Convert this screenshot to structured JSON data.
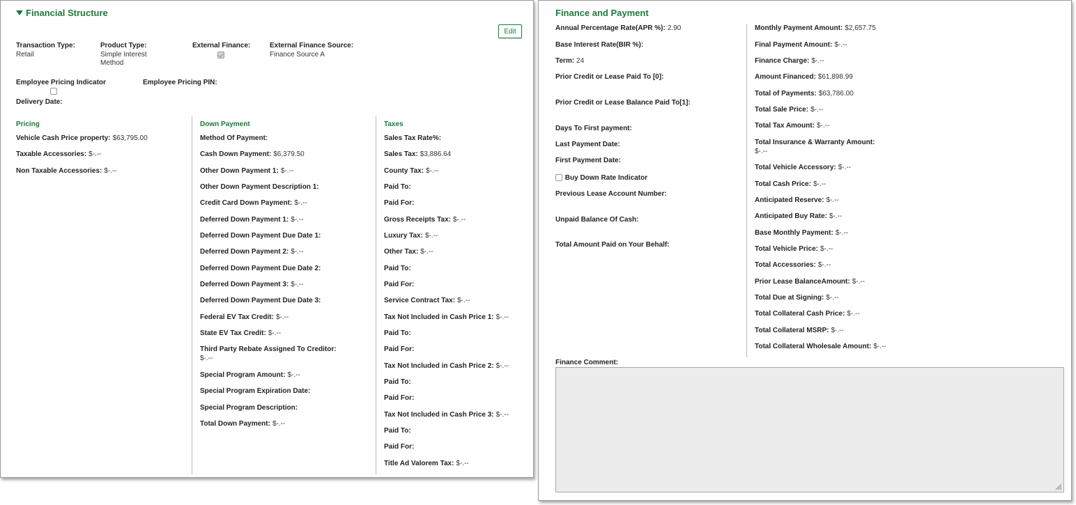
{
  "financial_structure": {
    "title": "Financial Structure",
    "edit_label": "Edit",
    "transaction_type": {
      "label": "Transaction Type:",
      "value": "Retail"
    },
    "product_type": {
      "label": "Product Type:",
      "value_line1": "Simple Interest",
      "value_line2": "Method"
    },
    "external_finance": {
      "label": "External Finance:",
      "checked": true
    },
    "external_finance_source": {
      "label": "External Finance Source:",
      "value": "Finance Source A"
    },
    "employee_pricing_indicator": {
      "label": "Employee Pricing Indicator",
      "checked": false
    },
    "employee_pricing_pin": {
      "label": "Employee Pricing PIN:"
    },
    "delivery_date": {
      "label": "Delivery Date:"
    },
    "pricing": {
      "heading": "Pricing",
      "rows": [
        {
          "label": "Vehicle Cash Price property:",
          "value": "$63,795.00"
        },
        {
          "label": "Taxable Accessories:",
          "value": "$-.--"
        },
        {
          "label": "Non Taxable Accessories:",
          "value": "$-.--"
        }
      ]
    },
    "down_payment": {
      "heading": "Down Payment",
      "rows": [
        {
          "label": "Method Of Payment:",
          "value": ""
        },
        {
          "label": "Cash Down Payment:",
          "value": "$6,379.50"
        },
        {
          "label": "Other Down Payment 1:",
          "value": "$-.--"
        },
        {
          "label": "Other Down Payment Description 1:",
          "value": ""
        },
        {
          "label": "Credit Card Down Payment:",
          "value": "$-.--"
        },
        {
          "label": "Deferred Down Payment 1:",
          "value": "$-.--"
        },
        {
          "label": "Deferred Down Payment Due Date 1:",
          "value": ""
        },
        {
          "label": "Deferred Down Payment 2:",
          "value": "$-.--"
        },
        {
          "label": "Deferred Down Payment Due Date 2:",
          "value": ""
        },
        {
          "label": "Deferred Down Payment 3:",
          "value": "$-.--"
        },
        {
          "label": "Deferred Down Payment Due Date 3:",
          "value": ""
        },
        {
          "label": "Federal EV Tax Credit:",
          "value": "$-.--"
        },
        {
          "label": "State EV Tax Credit:",
          "value": "$-.--"
        },
        {
          "label": "Third Party Rebate Assigned To Creditor:",
          "value": "$-.--"
        },
        {
          "label": "Special Program Amount:",
          "value": "$-.--"
        },
        {
          "label": "Special Program Expiration Date:",
          "value": ""
        },
        {
          "label": "Special Program Description:",
          "value": ""
        },
        {
          "label": "Total Down Payment:",
          "value": "$-.--"
        }
      ]
    },
    "taxes": {
      "heading": "Taxes",
      "rows": [
        {
          "label": "Sales Tax Rate%:",
          "value": ""
        },
        {
          "label": "Sales Tax:",
          "value": "$3,886.64"
        },
        {
          "label": "County Tax:",
          "value": "$-.--"
        },
        {
          "label": "Paid To:",
          "value": ""
        },
        {
          "label": "Paid For:",
          "value": ""
        },
        {
          "label": "Gross Receipts Tax:",
          "value": "$-.--"
        },
        {
          "label": "Luxury Tax:",
          "value": "$-.--"
        },
        {
          "label": "Other Tax:",
          "value": "$-.--"
        },
        {
          "label": "Paid To:",
          "value": ""
        },
        {
          "label": "Paid For:",
          "value": ""
        },
        {
          "label": "Service Contract Tax:",
          "value": "$-.--"
        },
        {
          "label": "Tax Not Included in Cash Price 1:",
          "value": "$-.--"
        },
        {
          "label": "Paid To:",
          "value": ""
        },
        {
          "label": "Paid For:",
          "value": ""
        },
        {
          "label": "Tax Not Included in Cash Price 2:",
          "value": "$-.--"
        },
        {
          "label": "Paid To:",
          "value": ""
        },
        {
          "label": "Paid For:",
          "value": ""
        },
        {
          "label": "Tax Not Included in Cash Price 3:",
          "value": "$-.--"
        },
        {
          "label": "Paid To:",
          "value": ""
        },
        {
          "label": "Paid For:",
          "value": ""
        },
        {
          "label": "Title Ad Valorem Tax:",
          "value": "$-.--"
        }
      ]
    }
  },
  "finance_payment": {
    "title": "Finance and Payment",
    "left_rows": [
      {
        "label": "Annual Percentage Rate(APR %):",
        "value": "2.90"
      },
      {
        "label": "Base Interest Rate(BIR %):",
        "value": ""
      },
      {
        "label": "Term:",
        "value": "24"
      },
      {
        "label": "Prior Credit or Lease Paid To [0]:",
        "value": ""
      },
      {
        "label": "Prior Credit or Lease Balance Paid To[1]:",
        "value": ""
      },
      {
        "label": "Days To First payment:",
        "value": ""
      },
      {
        "label": "Last Payment Date:",
        "value": ""
      },
      {
        "label": "First Payment Date:",
        "value": ""
      },
      {
        "label": "Previous Lease Account Number:",
        "value": ""
      },
      {
        "label": "Unpaid Balance Of Cash:",
        "value": ""
      },
      {
        "label": "Total Amount Paid on Your Behalf:",
        "value": ""
      }
    ],
    "buy_down_label": "Buy Down Rate Indicator",
    "right_rows": [
      {
        "label": "Monthly Payment Amount:",
        "value": "$2,657.75"
      },
      {
        "label": "Final Payment Amount:",
        "value": "$-.--"
      },
      {
        "label": "Finance Charge:",
        "value": "$-.--"
      },
      {
        "label": "Amount Financed:",
        "value": "$61,898.99"
      },
      {
        "label": "Total of Payments:",
        "value": "$63,786.00"
      },
      {
        "label": "Total Sale Price:",
        "value": "$-.--"
      },
      {
        "label": "Total Tax Amount:",
        "value": "$-.--"
      },
      {
        "label": "Total Insurance & Warranty Amount:",
        "value": "$-.--"
      },
      {
        "label": "Total Vehicle Accessory:",
        "value": "$-.--"
      },
      {
        "label": "Total Cash Price:",
        "value": "$-.--"
      },
      {
        "label": "Anticipated Reserve:",
        "value": "$-.--"
      },
      {
        "label": "Anticipated Buy Rate:",
        "value": "$-.--"
      },
      {
        "label": "Base Monthly Payment:",
        "value": "$-.--"
      },
      {
        "label": "Total Vehicle Price:",
        "value": "$-.--"
      },
      {
        "label": "Total Accessories:",
        "value": "$-.--"
      },
      {
        "label": "Prior Lease BalanceAmount:",
        "value": "$-.--"
      },
      {
        "label": "Total Due at Signing:",
        "value": "$-.--"
      },
      {
        "label": "Total Collateral Cash Price:",
        "value": "$-.--"
      },
      {
        "label": "Total Collateral MSRP:",
        "value": "$-.--"
      },
      {
        "label": "Total Collateral Wholesale Amount:",
        "value": "$-.--"
      }
    ],
    "finance_comment_label": "Finance Comment:",
    "finance_comment_value": ""
  }
}
